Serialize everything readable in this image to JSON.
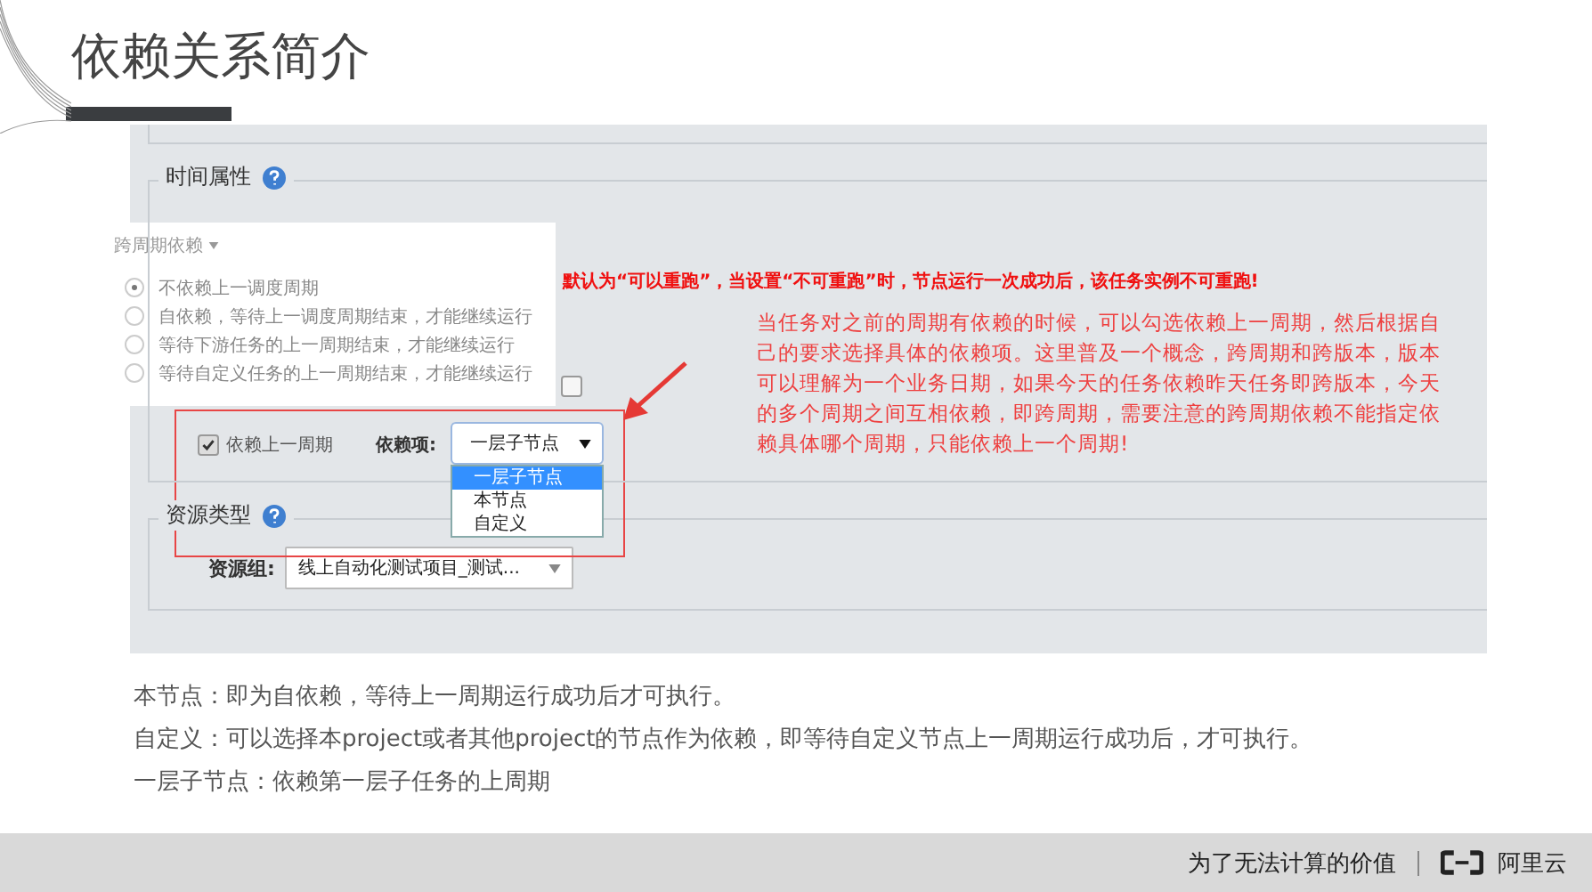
{
  "slide": {
    "title": "依赖关系简介"
  },
  "screenshot": {
    "time_section": {
      "legend": "时间属性"
    },
    "cross_cycle_popup": {
      "legend": "跨周期依赖",
      "options": [
        {
          "label": "不依赖上一调度周期",
          "selected": true
        },
        {
          "label": "自依赖，等待上一调度周期结束，才能继续运行",
          "selected": false
        },
        {
          "label": "等待下游任务的上一周期结束，才能继续运行",
          "selected": false
        },
        {
          "label": "等待自定义任务的上一周期结束，才能继续运行",
          "selected": false
        }
      ]
    },
    "rerun_note": "默认为“可以重跑”，当设置“不可重跑”时，节点运行一次成功后，该任务实例不可重跑!",
    "rerun_checkbox": {
      "checked": false
    },
    "depend_row": {
      "checkbox_label": "依赖上一周期",
      "checked": true,
      "select_label": "依赖项:",
      "select_value": "一层子节点",
      "options": [
        {
          "label": "一层子节点",
          "selected": true
        },
        {
          "label": "本节点",
          "selected": false
        },
        {
          "label": "自定义",
          "selected": false
        }
      ]
    },
    "annotation": "当任务对之前的周期有依赖的时候，可以勾选依赖上一周期，然后根据自己的要求选择具体的依赖项。这里普及一个概念，跨周期和跨版本，版本可以理解为一个业务日期，如果今天的任务依赖昨天任务即跨版本，今天的多个周期之间互相依赖，即跨周期，需要注意的跨周期依赖不能指定依赖具体哪个周期，只能依赖上一个周期!",
    "resource_section": {
      "legend": "资源类型",
      "group_label": "资源组:",
      "group_value": "线上自动化测试项目_测试..."
    }
  },
  "notes": [
    "本节点：即为自依赖，等待上一周期运行成功后才可执行。",
    "自定义：可以选择本project或者其他project的节点作为依赖，即等待自定义节点上一周期运行成功后，才可执行。",
    "一层子节点：依赖第一层子任务的上周期"
  ],
  "footer": {
    "slogan": "为了无法计算的价值",
    "logo_text": "阿里云"
  }
}
